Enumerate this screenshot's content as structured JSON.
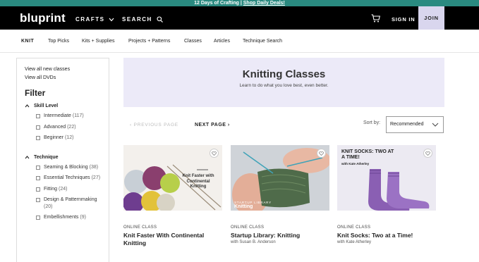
{
  "promo": {
    "text": "12 Days of Crafting |",
    "link": "Shop Daily Deals!"
  },
  "header": {
    "logo": "bluprint",
    "crafts": "CRAFTS",
    "search": "SEARCH",
    "signin": "SIGN IN",
    "join": "JOIN"
  },
  "subnav": {
    "current": "KNIT",
    "items": [
      "Top Picks",
      "Kits + Supplies",
      "Projects + Patterns",
      "Classes",
      "Articles",
      "Technique Search"
    ]
  },
  "sidebar": {
    "links": [
      "View all new classes",
      "View all DVDs"
    ],
    "filter_heading": "Filter",
    "skill_level": {
      "title": "Skill Level",
      "options": [
        {
          "label": "Intermediate",
          "count": "(117)"
        },
        {
          "label": "Advanced",
          "count": "(22)"
        },
        {
          "label": "Beginner",
          "count": "(12)"
        }
      ]
    },
    "technique": {
      "title": "Technique",
      "options": [
        {
          "label": "Seaming & Blocking",
          "count": "(38)"
        },
        {
          "label": "Essential Techniques",
          "count": "(27)"
        },
        {
          "label": "Fitting",
          "count": "(24)"
        },
        {
          "label": "Design & Patternmaking",
          "count": "(20)"
        },
        {
          "label": "Embellishments",
          "count": "(9)"
        }
      ]
    }
  },
  "banner": {
    "title": "Knitting Classes",
    "subtitle": "Learn to do what you love best, even better."
  },
  "pagination": {
    "prev": "‹ PREVIOUS PAGE",
    "next": "NEXT PAGE ›"
  },
  "sort": {
    "label": "Sort by:",
    "value": "Recommended"
  },
  "cards": [
    {
      "type": "ONLINE CLASS",
      "title": "Knit Faster With Continental Knitting",
      "instructor": "",
      "thumb_text": "Knit Faster with Continental Knitting"
    },
    {
      "type": "ONLINE CLASS",
      "title": "Startup Library: Knitting",
      "instructor": "with Susan B. Anderson",
      "thumb_small": "STARTUP LIBRARY",
      "thumb_big": "Knitting"
    },
    {
      "type": "ONLINE CLASS",
      "title": "Knit Socks: Two at a Time!",
      "instructor": "with Kate Atherley",
      "thumb_title": "KNIT SOCKS: TWO AT A TIME!",
      "thumb_sub": "with Kate Atherley"
    }
  ],
  "colors": {
    "promo": "#2a8a80",
    "nav": "#000000",
    "join": "#d9d6ee",
    "banner": "#eceaf8"
  }
}
